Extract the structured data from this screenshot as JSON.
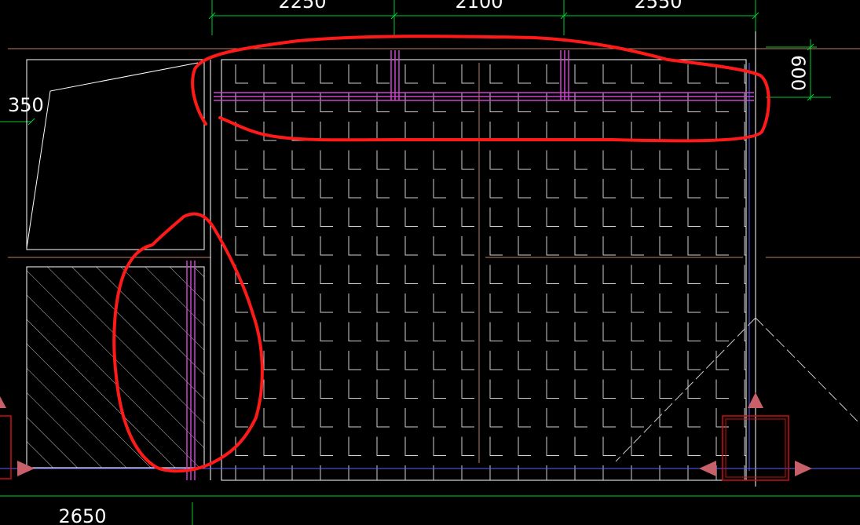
{
  "dimensions": {
    "top": [
      "2250",
      "2100",
      "2550"
    ],
    "left": "350",
    "right": "600",
    "bottom": "2650"
  },
  "colors": {
    "background": "#000000",
    "dimension_line": "#00cc33",
    "wall": "#ffffff",
    "tile_grid": "#cfcfcf",
    "axis": "#c08060",
    "rebar": "#cc44cc",
    "boundary": "#6060ff",
    "annotation": "#ff1a1a",
    "grip": "#c8606a",
    "selection_box": "#cc1111",
    "hatch": "#bdbdbd"
  },
  "icons": {
    "grip": "triangle-grip-icon",
    "annotation": "red-freehand-circle-icon"
  }
}
